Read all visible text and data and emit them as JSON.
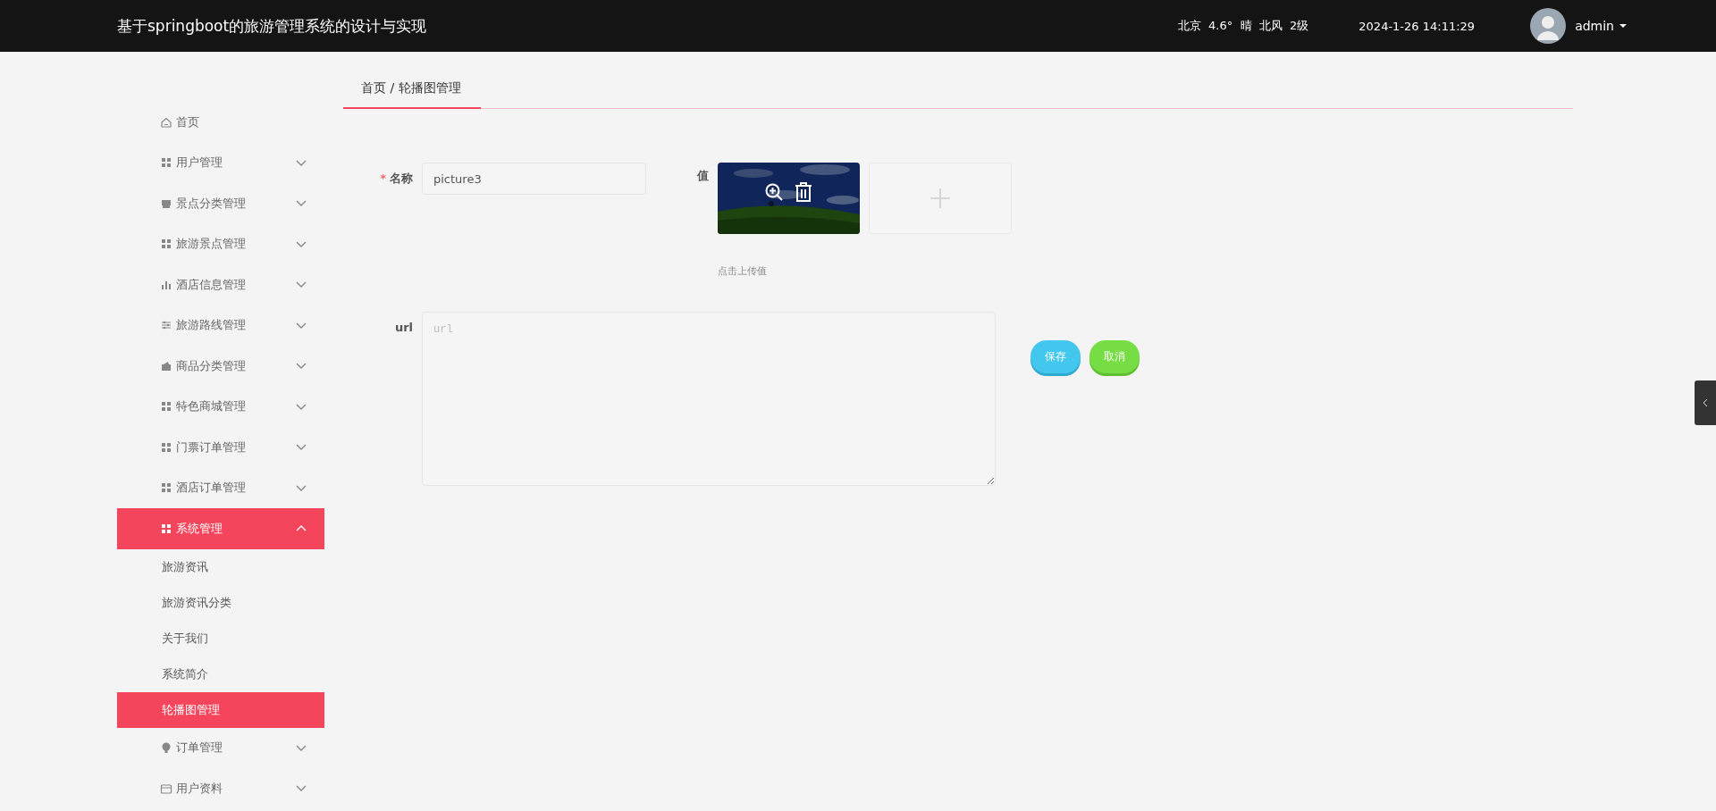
{
  "header": {
    "title": "基于springboot的旅游管理系统的设计与实现",
    "weather": "北京  4.6°  晴  北风  2级",
    "datetime": "2024-1-26 14:11:29",
    "user": "admin"
  },
  "sidebar": {
    "items": [
      {
        "label": "首页",
        "selected": false
      },
      {
        "label": "用户管理",
        "expanded": false,
        "selected": false
      },
      {
        "label": "景点分类管理",
        "expanded": false,
        "selected": false
      },
      {
        "label": "旅游景点管理",
        "expanded": false,
        "selected": false
      },
      {
        "label": "酒店信息管理",
        "expanded": false,
        "selected": false
      },
      {
        "label": "旅游路线管理",
        "expanded": false,
        "selected": false
      },
      {
        "label": "商品分类管理",
        "expanded": false,
        "selected": false
      },
      {
        "label": "特色商城管理",
        "expanded": false,
        "selected": false
      },
      {
        "label": "门票订单管理",
        "expanded": false,
        "selected": false
      },
      {
        "label": "酒店订单管理",
        "expanded": false,
        "selected": false
      },
      {
        "label": "系统管理",
        "expanded": true,
        "selected": true,
        "children": [
          {
            "label": "旅游资讯",
            "selected": false
          },
          {
            "label": "旅游资讯分类",
            "selected": false
          },
          {
            "label": "关于我们",
            "selected": false
          },
          {
            "label": "系统简介",
            "selected": false
          },
          {
            "label": "轮播图管理",
            "selected": true
          }
        ]
      },
      {
        "label": "订单管理",
        "expanded": false,
        "selected": false
      },
      {
        "label": "用户资料",
        "expanded": false,
        "selected": false
      }
    ]
  },
  "breadcrumb": "首页 / 轮播图管理",
  "form": {
    "name": {
      "label": "名称",
      "required_mark": "*",
      "value": "picture3"
    },
    "value": {
      "label": "值",
      "hint": "点击上传值"
    },
    "url": {
      "label": "url",
      "placeholder": "url"
    },
    "buttons": [
      {
        "label": "保存",
        "kind": "primary"
      },
      {
        "label": "取消",
        "kind": "cancel"
      }
    ]
  }
}
